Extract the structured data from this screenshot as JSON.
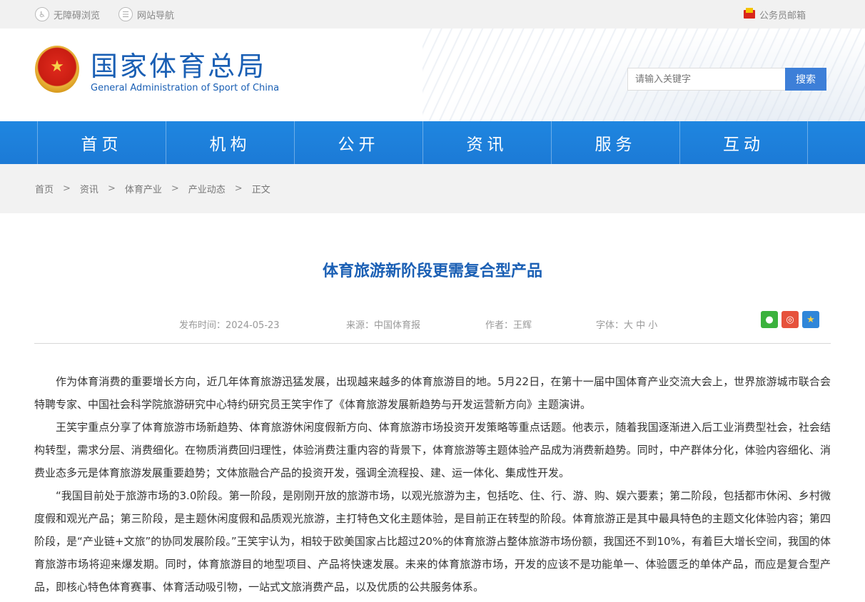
{
  "topbar": {
    "accessibility": "无障碍浏览",
    "site_nav": "网站导航",
    "staff_mail": "公务员邮箱"
  },
  "header": {
    "logo_cn": "国家体育总局",
    "logo_en": "General Administration of Sport of China",
    "search_placeholder": "请输入关键字",
    "search_button": "搜索"
  },
  "nav": {
    "items": [
      "首页",
      "机构",
      "公开",
      "资讯",
      "服务",
      "互动"
    ]
  },
  "breadcrumb": {
    "items": [
      "首页",
      "资讯",
      "体育产业",
      "产业动态",
      "正文"
    ],
    "separator": ">"
  },
  "article": {
    "title": "体育旅游新阶段更需复合型产品",
    "publish_time": "发布时间：2024-05-23",
    "source": "来源：中国体育报",
    "author": "作者：王辉",
    "font_label": "字体：大 中 小",
    "paragraphs": [
      "作为体育消费的重要增长方向，近几年体育旅游迅猛发展，出现越来越多的体育旅游目的地。5月22日，在第十一届中国体育产业交流大会上，世界旅游城市联合会特聘专家、中国社会科学院旅游研究中心特约研究员王笑宇作了《体育旅游发展新趋势与开发运营新方向》主题演讲。",
      "王笑宇重点分享了体育旅游市场新趋势、体育旅游休闲度假新方向、体育旅游市场投资开发策略等重点话题。他表示，随着我国逐渐进入后工业消费型社会，社会结构转型，需求分层、消费细化。在物质消费回归理性，体验消费注重内容的背景下，体育旅游等主题体验产品成为消费新趋势。同时，中产群体分化，体验内容细化、消费业态多元是体育旅游发展重要趋势；文体旅融合产品的投资开发，强调全流程投、建、运一体化、集成性开发。",
      "“我国目前处于旅游市场的3.0阶段。第一阶段，是刚刚开放的旅游市场，以观光旅游为主，包括吃、住、行、游、购、娱六要素；第二阶段，包括都市休闲、乡村微度假和观光产品；第三阶段，是主题休闲度假和品质观光旅游，主打特色文化主题体验，是目前正在转型的阶段。体育旅游正是其中最具特色的主题文化体验内容；第四阶段，是“产业链+文旅”的协同发展阶段。”王笑宇认为，相较于欧美国家占比超过20%的体育旅游占整体旅游市场份额，我国还不到10%，有着巨大增长空间，我国的体育旅游市场将迎来爆发期。同时，体育旅游目的地型项目、产品将快速发展。未来的体育旅游市场，开发的应该不是功能单一、体验匮乏的单体产品，而应是复合型产品，即核心特色体育赛事、体育活动吸引物，一站式文旅消费产品，以及优质的公共服务体系。"
    ]
  },
  "colors": {
    "brand_blue": "#1a5fb4",
    "nav_blue": "#1f86e0",
    "search_button": "#3d7fd8"
  },
  "icons": [
    "accessibility-icon",
    "site-nav-icon",
    "mail-icon",
    "national-emblem",
    "wechat-icon",
    "weibo-icon",
    "favorite-icon"
  ]
}
